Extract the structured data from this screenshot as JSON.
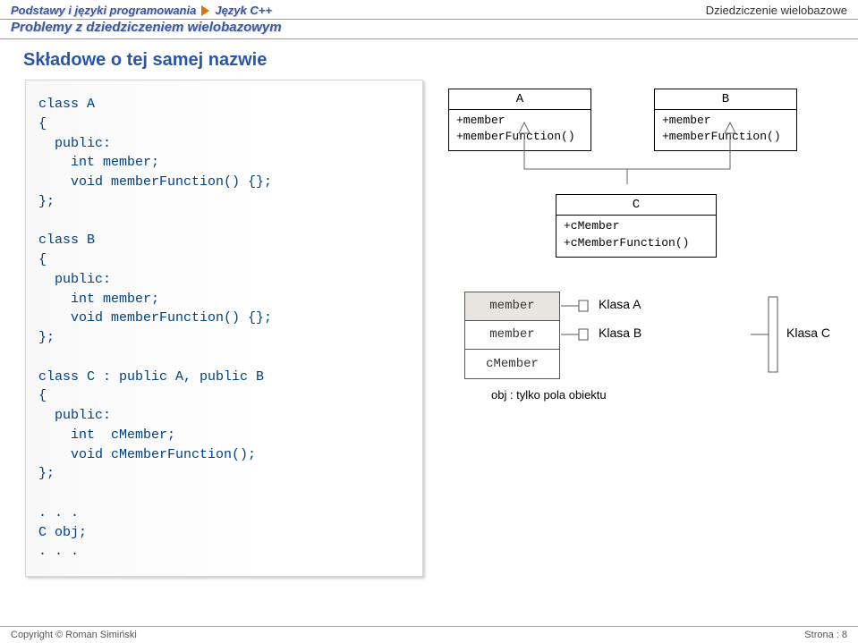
{
  "header": {
    "crumb1": "Podstawy i języki programowania",
    "crumb2": "Język C++",
    "right": "Dziedziczenie wielobazowe"
  },
  "subheader": "Problemy z dziedziczeniem wielobazowym",
  "section_title": "Składowe o tej samej nazwie",
  "code": "class A\n{\n  public:\n    int member;\n    void memberFunction() {};\n};\n\nclass B\n{\n  public:\n    int member;\n    void memberFunction() {};\n};\n\nclass C : public A, public B\n{\n  public:\n    int  cMember;\n    void cMemberFunction();\n};\n\n. . .\nC obj;\n. . .",
  "uml": {
    "a": {
      "name": "A",
      "line1": "+member",
      "line2": "+memberFunction()"
    },
    "b": {
      "name": "B",
      "line1": "+member",
      "line2": "+memberFunction()"
    },
    "c": {
      "name": "C",
      "line1": "+cMember",
      "line2": "+cMemberFunction()"
    }
  },
  "obj": {
    "cell1": "member",
    "cell2": "member",
    "cell3": "cMember",
    "label_a": "Klasa A",
    "label_b": "Klasa B",
    "label_c": "Klasa C",
    "caption": "obj : tylko pola obiektu"
  },
  "footer": {
    "left": "Copyright © Roman Simiński",
    "right": "Strona : 8"
  },
  "chart_data": {
    "type": "diagram",
    "uml_classes": [
      {
        "name": "A",
        "members": [
          "+member"
        ],
        "methods": [
          "+memberFunction()"
        ]
      },
      {
        "name": "B",
        "members": [
          "+member"
        ],
        "methods": [
          "+memberFunction()"
        ]
      },
      {
        "name": "C",
        "members": [
          "+cMember"
        ],
        "methods": [
          "+cMemberFunction()"
        ],
        "inherits": [
          "A",
          "B"
        ]
      }
    ],
    "object_layout": {
      "name": "obj",
      "fields": [
        {
          "field": "member",
          "from": "Klasa A"
        },
        {
          "field": "member",
          "from": "Klasa B"
        },
        {
          "field": "cMember",
          "from": "Klasa C"
        }
      ],
      "caption": "obj : tylko pola obiektu"
    }
  }
}
